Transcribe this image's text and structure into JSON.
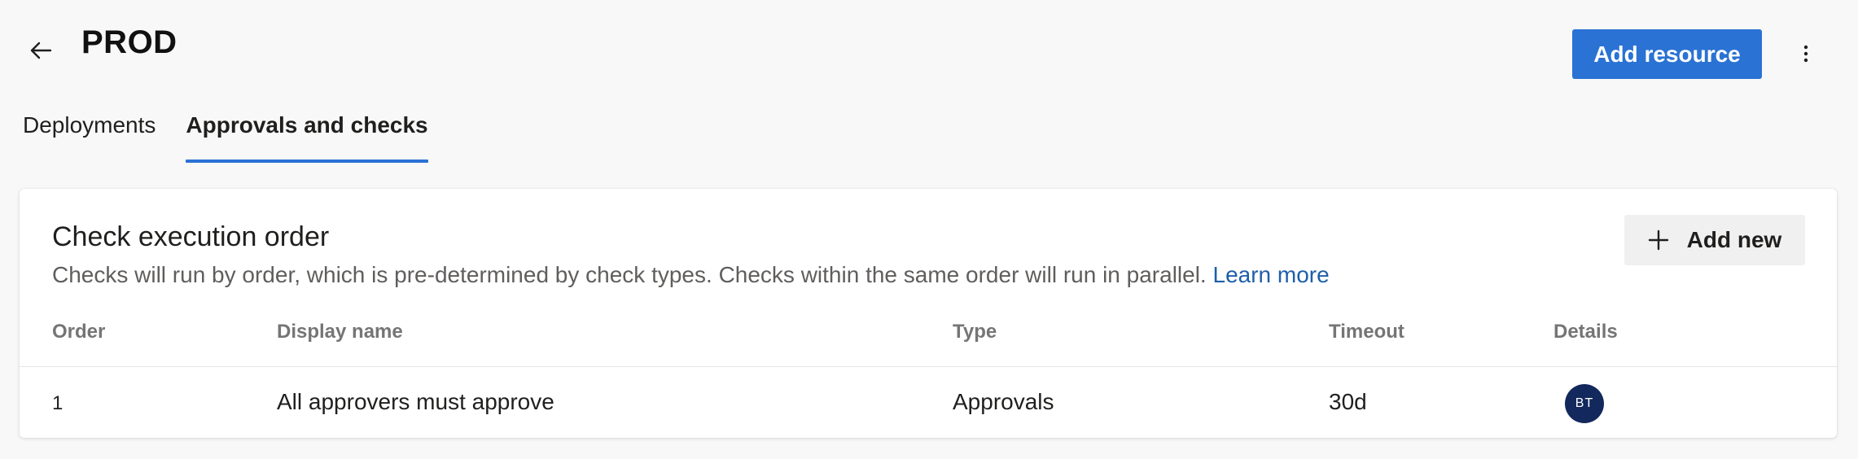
{
  "header": {
    "title": "PROD",
    "add_resource_label": "Add resource"
  },
  "tabs": [
    {
      "label": "Deployments",
      "active": false
    },
    {
      "label": "Approvals and checks",
      "active": true
    }
  ],
  "card": {
    "title": "Check execution order",
    "description": "Checks will run by order, which is pre-determined by check types. Checks within the same order will run in parallel.",
    "learn_more": "Learn more",
    "add_new_label": "Add new",
    "columns": [
      "Order",
      "Display name",
      "Type",
      "Timeout",
      "Details"
    ],
    "rows": [
      {
        "order": "1",
        "display_name": "All approvers must approve",
        "type": "Approvals",
        "timeout": "30d",
        "avatar_initials": "BT"
      }
    ]
  },
  "colors": {
    "accent": "#2a72d4",
    "link": "#1e5fa8",
    "avatar_bg": "#13285c",
    "page_bg": "#f8f8f8"
  },
  "icons": {
    "back": "arrow-left-icon",
    "more": "more-vertical-icon",
    "add": "plus-icon"
  }
}
